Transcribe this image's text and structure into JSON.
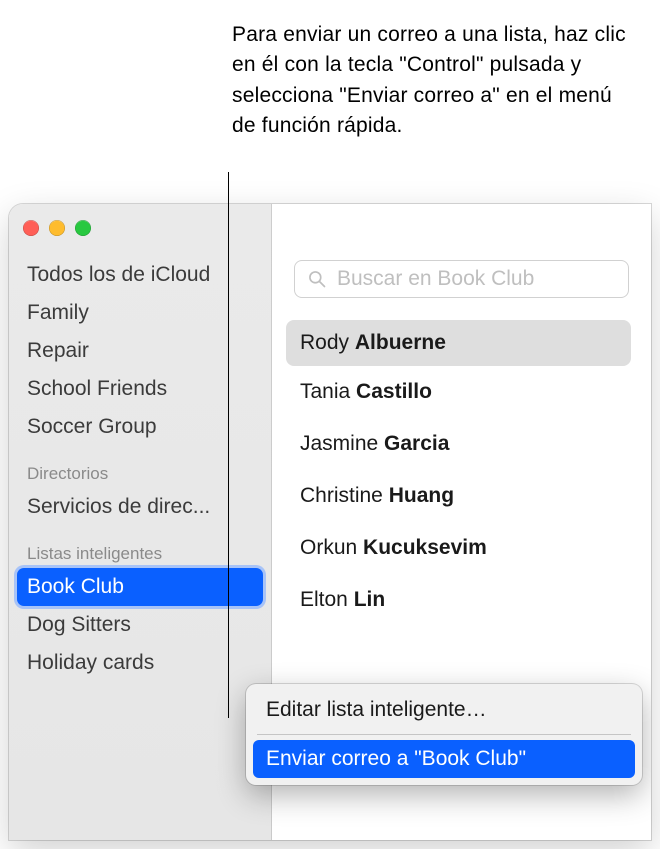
{
  "callout": "Para enviar un correo a una lista, haz clic en él con la tecla \"Control\" pulsada y selecciona \"Enviar correo a\" en el menú de función rápida.",
  "sidebar": {
    "groups": [
      {
        "label": "Todos los de iCloud"
      },
      {
        "label": "Family"
      },
      {
        "label": "Repair"
      },
      {
        "label": "School Friends"
      },
      {
        "label": "Soccer Group"
      }
    ],
    "directories_header": "Directorios",
    "directories": [
      {
        "label": "Servicios de direc..."
      }
    ],
    "smartlists_header": "Listas inteligentes",
    "smartlists": [
      {
        "label": "Book Club",
        "selected": true
      },
      {
        "label": "Dog Sitters"
      },
      {
        "label": "Holiday cards"
      }
    ]
  },
  "search": {
    "placeholder": "Buscar en Book Club"
  },
  "contacts": [
    {
      "first": "Rody",
      "last": "Albuerne",
      "selected": true
    },
    {
      "first": "Tania",
      "last": "Castillo"
    },
    {
      "first": "Jasmine",
      "last": "Garcia"
    },
    {
      "first": "Christine",
      "last": "Huang"
    },
    {
      "first": "Orkun",
      "last": "Kucuksevim"
    },
    {
      "first": "Elton",
      "last": "Lin"
    }
  ],
  "context_menu": {
    "edit": "Editar lista inteligente…",
    "send": "Enviar correo a \"Book Club\""
  }
}
